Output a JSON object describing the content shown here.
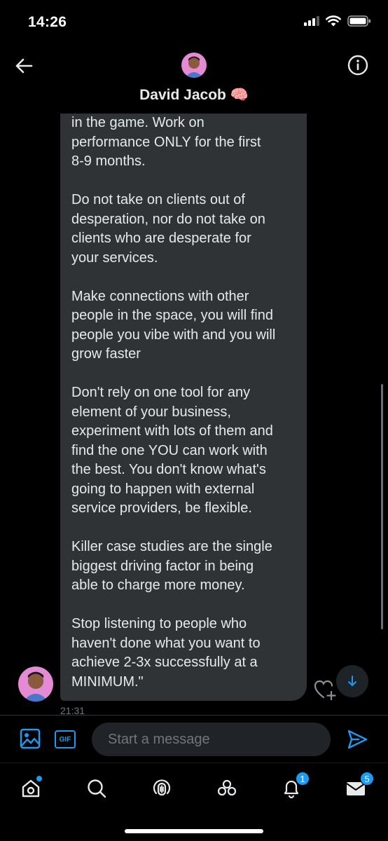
{
  "status_bar": {
    "time": "14:26",
    "icons": [
      "signal-icon",
      "wifi-icon",
      "battery-icon"
    ]
  },
  "header": {
    "contact_name": "David Jacob 🧠",
    "back_icon": "back-arrow-icon",
    "info_icon": "info-icon"
  },
  "message": {
    "paragraphs": [
      [
        "in the game. Work on",
        "performance ONLY for the first",
        "8-9 months."
      ],
      [
        "Do not take on clients out of",
        "desperation, nor do not take on",
        "clients who are desperate for",
        "your services."
      ],
      [
        "Make connections with other",
        "people in the space, you will find",
        "people you vibe with and you will",
        "grow faster"
      ],
      [
        "Don't rely on one tool for any",
        "element of your business,",
        "experiment with lots of them and",
        "find the one YOU can work with",
        "the best. You don't know what's",
        "going to happen with external",
        "service providers, be flexible."
      ],
      [
        "Killer case studies are the single",
        "biggest driving factor in being",
        "able to charge more money."
      ],
      [
        "Stop listening to people who",
        "haven't done what you want to",
        "achieve 2-3x successfully at a",
        "MINIMUM.\""
      ]
    ],
    "timestamp": "21:31"
  },
  "composer": {
    "placeholder": "Start a message",
    "gif_label": "GIF"
  },
  "tab_bar": {
    "tabs": [
      {
        "icon": "home-icon",
        "badge": ""
      },
      {
        "icon": "search-icon",
        "badge": ""
      },
      {
        "icon": "spaces-icon",
        "badge": ""
      },
      {
        "icon": "communities-icon",
        "badge": ""
      },
      {
        "icon": "notifications-icon",
        "badge": "1"
      },
      {
        "icon": "messages-icon",
        "badge": "5"
      }
    ]
  },
  "colors": {
    "accent": "#1d9bf0",
    "bubble": "#2f3336",
    "background": "#000000",
    "text": "#e7e9ea",
    "muted": "#71767b"
  }
}
